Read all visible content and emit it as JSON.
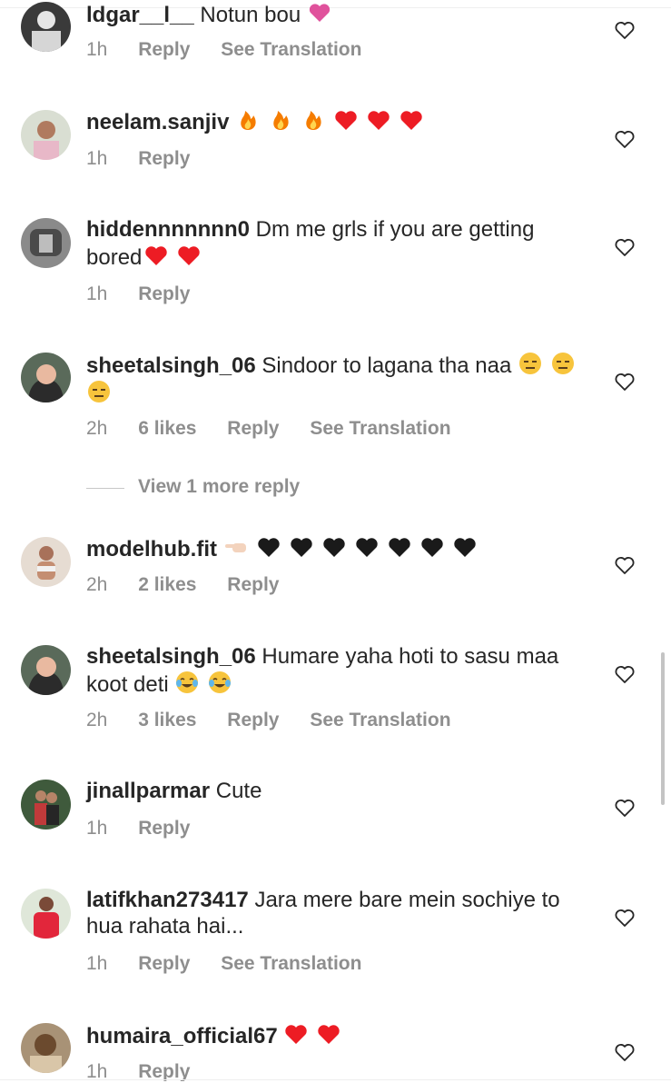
{
  "comments": [
    {
      "username": "ldgar__l__",
      "text": "Notun bou",
      "emojis": "💗",
      "time": "1h",
      "likes": "",
      "reply": "Reply",
      "see_translation": "See Translation"
    },
    {
      "username": "neelam.sanjiv",
      "text": "",
      "emojis": "🔥🔥🔥❤️❤️❤️",
      "time": "1h",
      "likes": "",
      "reply": "Reply",
      "see_translation": ""
    },
    {
      "username": "hiddennnnnnn0",
      "text": "Dm me grls if you are getting bored",
      "emojis": "❤️❤️",
      "time": "1h",
      "likes": "",
      "reply": "Reply",
      "see_translation": ""
    },
    {
      "username": "sheetalsingh_06",
      "text": "Sindoor to lagana tha naa",
      "emojis": "😑😑😑",
      "time": "2h",
      "likes": "6 likes",
      "reply": "Reply",
      "see_translation": "See Translation"
    },
    {
      "username": "modelhub.fit",
      "text": "",
      "emojis": "👈🏻🖤🖤🖤🖤🖤🖤🖤",
      "time": "2h",
      "likes": "2 likes",
      "reply": "Reply",
      "see_translation": ""
    },
    {
      "username": "sheetalsingh_06",
      "text": "Humare yaha hoti to sasu maa koot deti",
      "emojis": "😂😂",
      "time": "2h",
      "likes": "3 likes",
      "reply": "Reply",
      "see_translation": "See Translation"
    },
    {
      "username": "jinallparmar",
      "text": "Cute",
      "emojis": "",
      "time": "1h",
      "likes": "",
      "reply": "Reply",
      "see_translation": ""
    },
    {
      "username": "latifkhan273417",
      "text": "Jara mere bare mein sochiye to hua rahata hai...",
      "emojis": "",
      "time": "1h",
      "likes": "",
      "reply": "Reply",
      "see_translation": "See Translation"
    },
    {
      "username": "humaira_official67",
      "text": "",
      "emojis": "❤️❤️",
      "time": "1h",
      "likes": "",
      "reply": "Reply",
      "see_translation": ""
    }
  ],
  "view_more_replies": "View 1 more reply",
  "colors": {
    "text": "#262626",
    "meta": "#8e8e8e",
    "heart_red": "#ed1c24",
    "fire": "#f57c00",
    "black_heart": "#1a1a1a",
    "face_yellow": "#f7c43c"
  },
  "icons": {
    "like": "heart-outline-icon",
    "avatar": "avatar-photo"
  }
}
